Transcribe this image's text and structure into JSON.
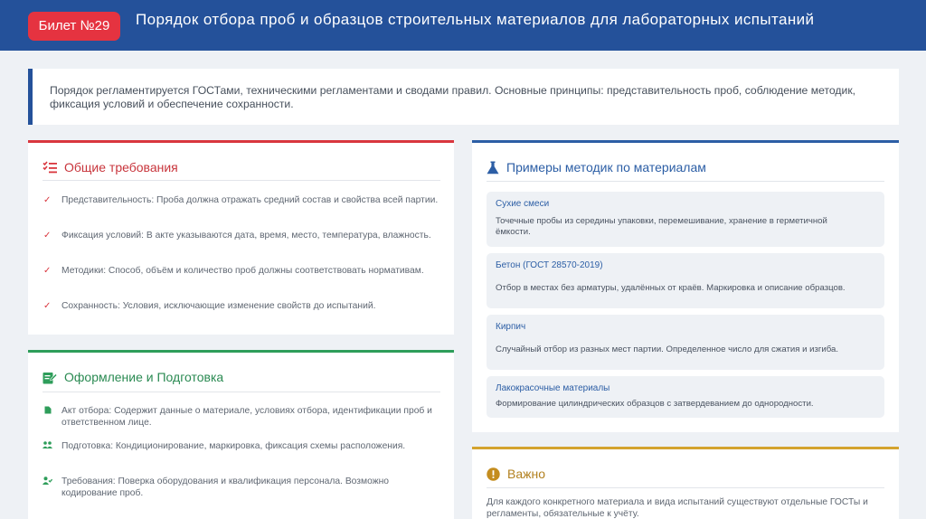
{
  "header": {
    "badge": "Билет №29",
    "title": "Порядок отбора проб и образцов строительных материалов для лабораторных испытаний"
  },
  "intro": {
    "text": "Порядок регламентируется ГОСТами, техническими регламентами и сводами правил. Основные принципы: представительность проб, соблюдение методик, фиксация условий и обеспечение сохранности."
  },
  "general": {
    "title": "Общие требования",
    "items": [
      "Представительность: Проба должна отражать средний состав и свойства всей партии.",
      "Фиксация условий: В акте указываются дата, время, место, температура, влажность.",
      "Методики: Способ, объём и количество проб должны соответствовать нормативам.",
      "Сохранность: Условия, исключающие изменение свойств до испытаний."
    ]
  },
  "prep": {
    "title": "Оформление и Подготовка",
    "items": [
      "Акт отбора: Содержит данные о материале, условиях отбора, идентификации проб и ответственном лице.",
      "Подготовка: Кондиционирование, маркировка, фиксация схемы расположения.",
      "Требования: Поверка оборудования и квалификация персонала. Возможно кодирование проб."
    ]
  },
  "methods": {
    "title": "Примеры методик по материалам",
    "items": [
      {
        "name": "Сухие смеси",
        "desc": "Точечные пробы из середины упаковки, перемешивание, хранение в герметичной ёмкости."
      },
      {
        "name": "Бетон (ГОСТ 28570-2019)",
        "desc": "Отбор в местах без арматуры, удалённых от краёв. Маркировка и описание образцов."
      },
      {
        "name": "Кирпич",
        "desc": "Случайный отбор из разных мест партии. Определенное число для сжатия и изгиба."
      },
      {
        "name": "Лакокрасочные материалы",
        "desc": "Формирование цилиндрических образцов с затвердеванием до однородности."
      }
    ]
  },
  "important": {
    "title": "Важно",
    "text": "Для каждого конкретного материала и вида испытаний существуют отдельные ГОСТы и регламенты, обязательные к учёту."
  },
  "colors": {
    "header": "#24519a",
    "badge": "#e53340",
    "red": "#d9363e",
    "green": "#2e9d5a",
    "blue": "#2c5ea5",
    "gold": "#d4a32e"
  }
}
